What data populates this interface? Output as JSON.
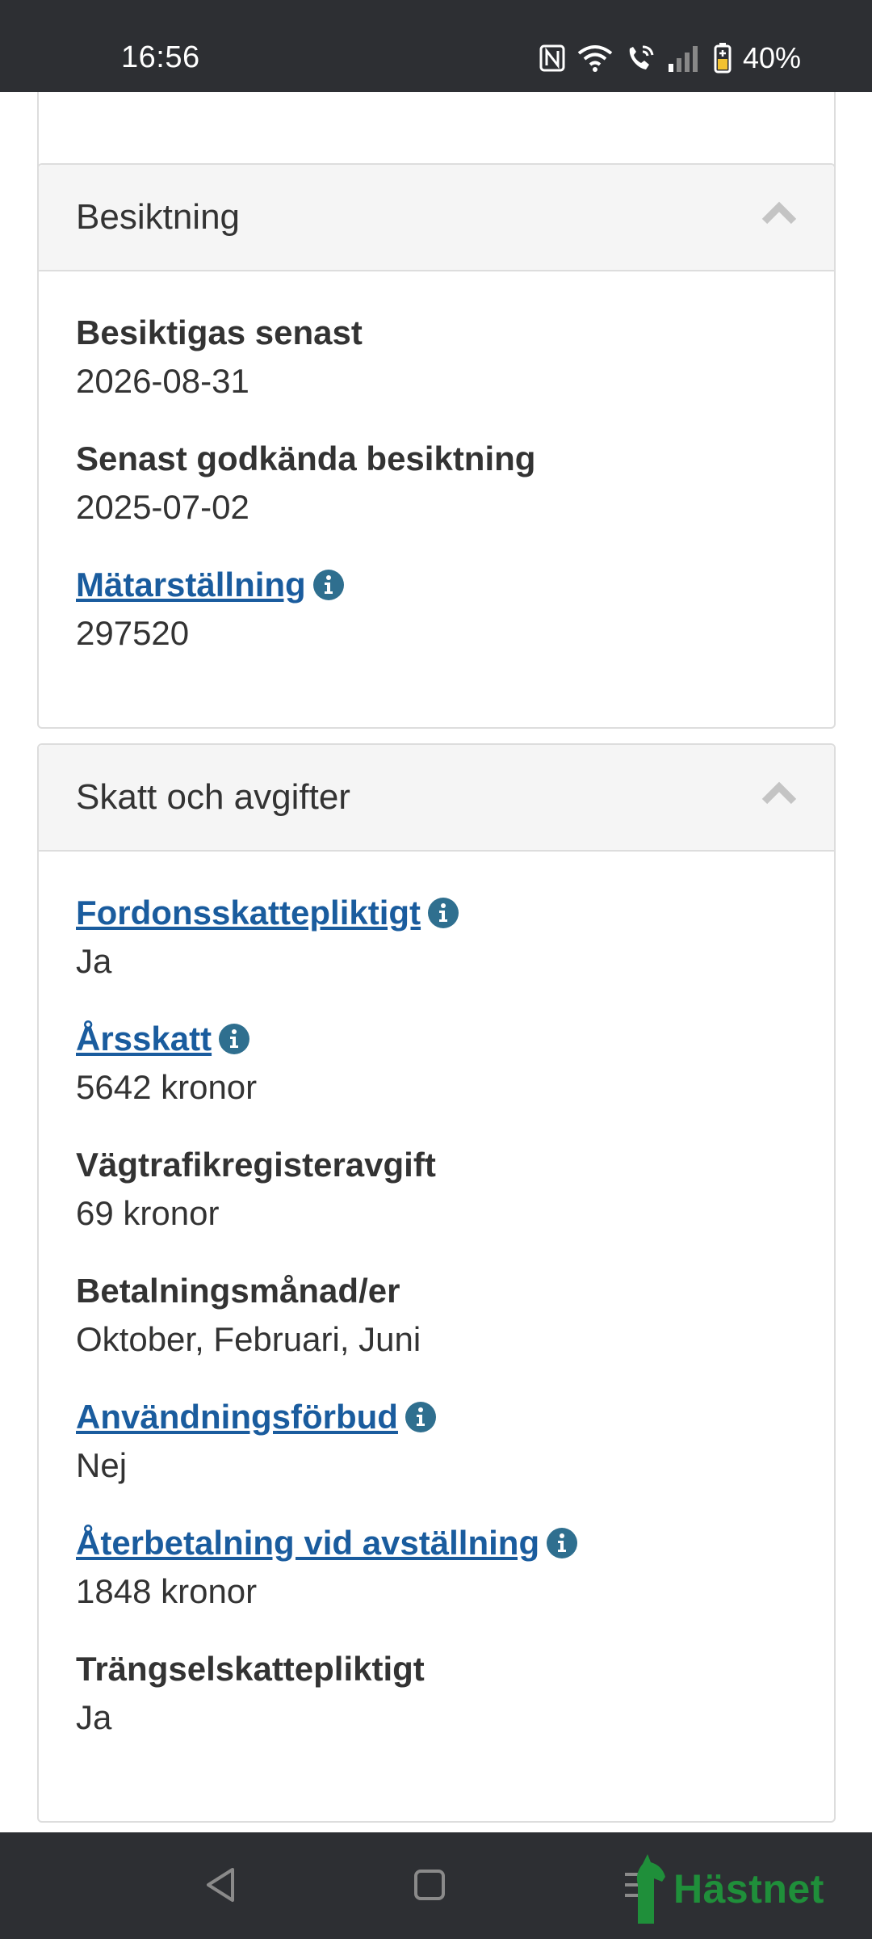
{
  "status_bar": {
    "time": "16:56",
    "battery": "40%",
    "icons": [
      "nfc-icon",
      "wifi-icon",
      "wifi-calling-icon",
      "signal-icon",
      "battery-icon"
    ]
  },
  "sections": {
    "inspection": {
      "title": "Besiktning",
      "fields": [
        {
          "label": "Besiktigas senast",
          "value": "2026-08-31"
        },
        {
          "label": "Senast godkända besiktning",
          "value": "2025-07-02"
        },
        {
          "label": "Mätarställning",
          "value": "297520"
        }
      ]
    },
    "tax": {
      "title": "Skatt och avgifter",
      "fields": [
        {
          "label": "Fordonsskattepliktigt",
          "value": "Ja"
        },
        {
          "label": "Årsskatt",
          "value": "5642 kronor"
        },
        {
          "label": "Vägtrafikregisteravgift",
          "value": "69 kronor"
        },
        {
          "label": "Betalningsmånad/er",
          "value": "Oktober, Februari, Juni"
        },
        {
          "label": "Användningsförbud",
          "value": "Nej"
        },
        {
          "label": "Återbetalning vid avställning",
          "value": "1848 kronor"
        },
        {
          "label": "Trängselskattepliktigt",
          "value": "Ja"
        }
      ]
    }
  },
  "watermark": {
    "text": "Hästnet",
    "color": "#1f8f3a"
  },
  "colors": {
    "link": "#1a5c9e",
    "info_icon": "#2f6f8f",
    "panel_heading_bg": "#f5f5f5"
  }
}
